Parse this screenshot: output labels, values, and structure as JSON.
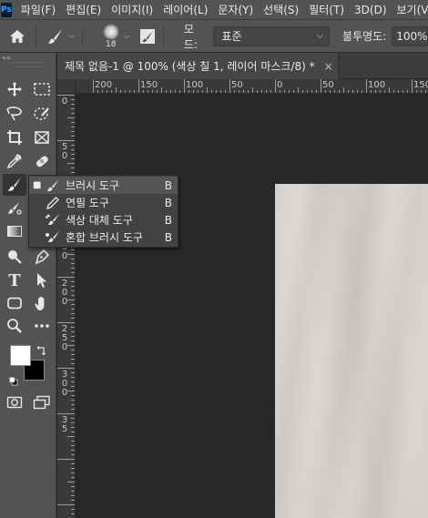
{
  "app": {
    "logo": "Ps"
  },
  "menu": {
    "items": [
      "파일(F)",
      "편집(E)",
      "이미지(I)",
      "레이어(L)",
      "문자(Y)",
      "선택(S)",
      "필터(T)",
      "3D(D)",
      "보기(V)"
    ]
  },
  "options_bar": {
    "brush_size": "18",
    "mode_label": "모드:",
    "mode_value": "표준",
    "opacity_label": "불투명도:",
    "opacity_value": "100%"
  },
  "document_tab": {
    "title": "제목 없음-1 @ 100% (색상 칠 1, 레이어 마스크/8) *",
    "close": "×"
  },
  "tools_header": {
    "collapse_glyph": "««"
  },
  "ruler": {
    "horizontal_labels": [
      "200",
      "150",
      "100",
      "50",
      "0",
      "50",
      "100",
      "150"
    ],
    "vertical_labels": [
      "0",
      "5",
      "0",
      "1",
      "0",
      "0",
      "1",
      "5",
      "0",
      "2",
      "0",
      "0",
      "2",
      "5",
      "0",
      "3",
      "0",
      "0",
      "3",
      "5"
    ]
  },
  "flyout": {
    "items": [
      {
        "label": "브러시 도구",
        "key": "B",
        "icon": "brush-icon",
        "selected": true
      },
      {
        "label": "연필 도구",
        "key": "B",
        "icon": "pencil-icon",
        "selected": false
      },
      {
        "label": "색상 대체 도구",
        "key": "B",
        "icon": "color-replacement-icon",
        "selected": false
      },
      {
        "label": "혼합 브러시 도구",
        "key": "B",
        "icon": "mixer-brush-icon",
        "selected": false
      }
    ]
  },
  "colors": {
    "foreground": "#ffffff",
    "background": "#000000",
    "canvas_fill": "#d6d1cd",
    "panel": "#535353",
    "workspace": "#282828"
  }
}
